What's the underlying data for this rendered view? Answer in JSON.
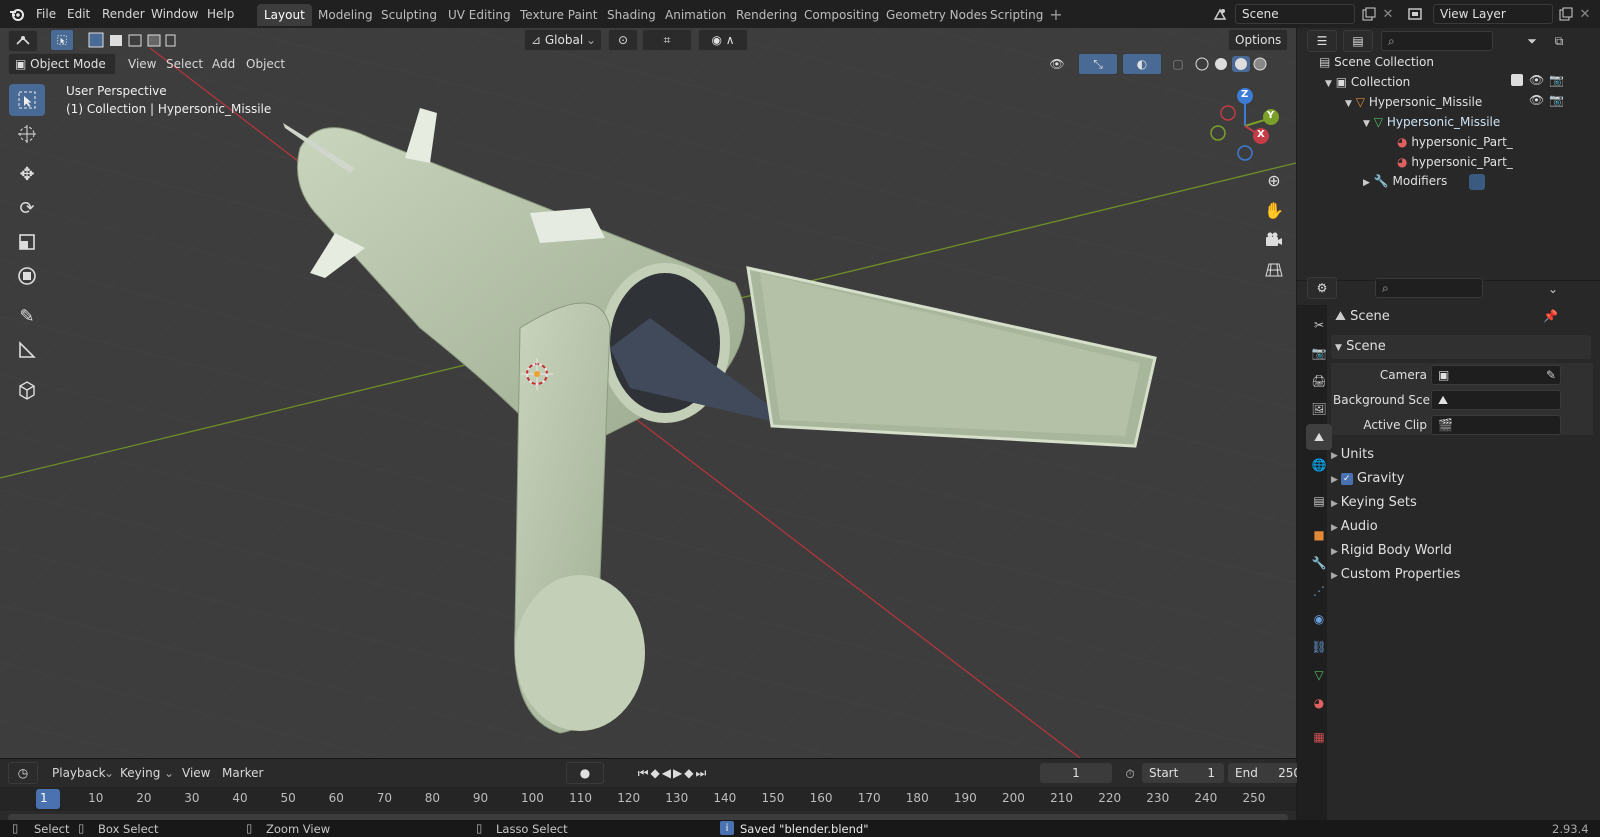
{
  "menus": [
    "File",
    "Edit",
    "Render",
    "Window",
    "Help"
  ],
  "workspaces": [
    "Layout",
    "Modeling",
    "Sculpting",
    "UV Editing",
    "Texture Paint",
    "Shading",
    "Animation",
    "Rendering",
    "Compositing",
    "Geometry Nodes",
    "Scripting"
  ],
  "active_workspace": "Layout",
  "scene_name": "Scene",
  "view_layer": "View Layer",
  "viewport": {
    "mode": "Object Mode",
    "header_menus": [
      "View",
      "Select",
      "Add",
      "Object"
    ],
    "transform_orientation": "Global",
    "options_label": "Options",
    "overlay_title": "User Perspective",
    "overlay_subtitle": "(1) Collection | Hypersonic_Missile",
    "gizmo_axes": {
      "x": "X",
      "y": "Y",
      "z": "Z"
    }
  },
  "outliner": {
    "rows": [
      {
        "label": "Scene Collection"
      },
      {
        "label": "Collection"
      },
      {
        "label": "Hypersonic_Missile"
      },
      {
        "label": "Hypersonic_Missile"
      },
      {
        "label": "hypersonic_Part_"
      },
      {
        "label": "hypersonic_Part_"
      },
      {
        "label": "Modifiers"
      }
    ]
  },
  "properties": {
    "context_name": "Scene",
    "section_title": "Scene",
    "fields": [
      {
        "label": "Camera",
        "value": ""
      },
      {
        "label": "Background Sce...",
        "value": ""
      },
      {
        "label": "Active Clip",
        "value": ""
      }
    ],
    "panels": [
      "Units",
      "Gravity",
      "Keying Sets",
      "Audio",
      "Rigid Body World",
      "Custom Properties"
    ],
    "gravity_checked": true
  },
  "timeline": {
    "menus": [
      "Playback",
      "Keying",
      "View",
      "Marker"
    ],
    "current_frame": "1",
    "start_label": "Start",
    "start_value": "1",
    "end_label": "End",
    "end_value": "250",
    "ruler": [
      "1",
      "10",
      "20",
      "30",
      "40",
      "50",
      "60",
      "70",
      "80",
      "90",
      "100",
      "110",
      "120",
      "130",
      "140",
      "150",
      "160",
      "170",
      "180",
      "190",
      "200",
      "210",
      "220",
      "230",
      "240",
      "250"
    ]
  },
  "status_bar": {
    "items": [
      "Select",
      "Box Select",
      "Zoom View",
      "Lasso Select"
    ],
    "message": "Saved \"blender.blend\"",
    "version": "2.93.4"
  },
  "colors": {
    "accent": "#4a72b0",
    "x_axis": "#c43c46",
    "y_axis": "#7aa02a",
    "z_axis": "#3d7cd6",
    "model": "#b9c6ad"
  }
}
